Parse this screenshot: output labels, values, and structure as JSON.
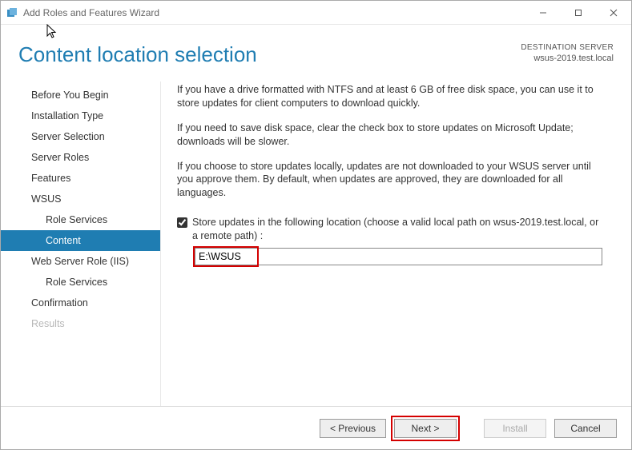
{
  "window": {
    "title": "Add Roles and Features Wizard"
  },
  "header": {
    "title": "Content location selection",
    "dest_label": "DESTINATION SERVER",
    "dest_server": "wsus-2019.test.local"
  },
  "sidebar": {
    "items": [
      {
        "label": "Before You Begin"
      },
      {
        "label": "Installation Type"
      },
      {
        "label": "Server Selection"
      },
      {
        "label": "Server Roles"
      },
      {
        "label": "Features"
      },
      {
        "label": "WSUS"
      },
      {
        "label": "Role Services"
      },
      {
        "label": "Content"
      },
      {
        "label": "Web Server Role (IIS)"
      },
      {
        "label": "Role Services"
      },
      {
        "label": "Confirmation"
      },
      {
        "label": "Results"
      }
    ]
  },
  "content": {
    "para1": "If you have a drive formatted with NTFS and at least 6 GB of free disk space, you can use it to store updates for client computers to download quickly.",
    "para2": "If you need to save disk space, clear the check box to store updates on Microsoft Update; downloads will be slower.",
    "para3": "If you choose to store updates locally, updates are not downloaded to your WSUS server until you approve them. By default, when updates are approved, they are downloaded for all languages.",
    "checkbox_label": "Store updates in the following location (choose a valid local path on wsus-2019.test.local, or a remote path) :",
    "checkbox_checked": true,
    "path_value": "E:\\WSUS"
  },
  "footer": {
    "previous": "< Previous",
    "next": "Next >",
    "install": "Install",
    "cancel": "Cancel"
  }
}
